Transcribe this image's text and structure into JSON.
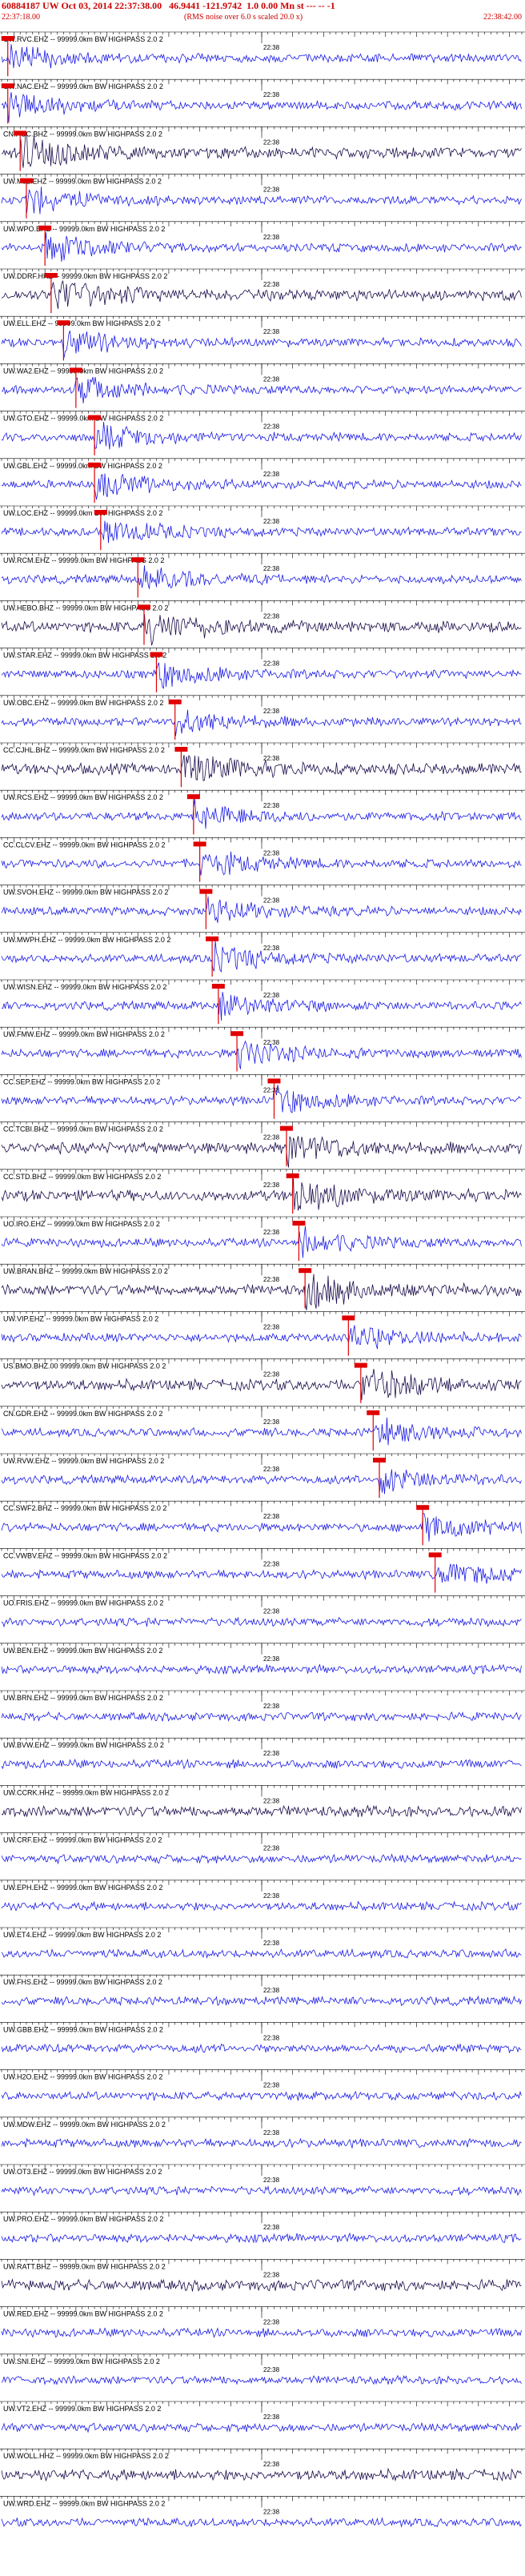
{
  "header": {
    "title": "60884187 UW Oct 03, 2014 22:37:38.00   46.9441 -121.9742  1.0 0.00 Mn st --- -- -1",
    "start_time": "22:37:18.00",
    "end_time": "22:38:42.00",
    "noise_note": "(RMS noise over 6.0 s scaled 20.0 x)"
  },
  "tick_label": "22:38",
  "colors": {
    "trace": "#1a1ae6",
    "dark_trace": "#1a0a4a",
    "pick": "#e00000",
    "text": "#000000"
  },
  "chart_data": {
    "type": "line",
    "title": "60884187 UW Oct 03, 2014 22:37:38.00   46.9441 -121.9742  1.0 0.00 Mn st --- -- -1",
    "x_range": [
      "22:37:18.00",
      "22:38:42.00"
    ],
    "series": [
      {
        "name": "UW.RVC.EHZ -- 99999.0km BW  HIGHPASS  2.0  2",
        "pick": "22:37:19",
        "color": "blue"
      },
      {
        "name": "UW.NAC.EHZ -- 99999.0km BW  HIGHPASS  2.0  2",
        "pick": "22:37:19",
        "color": "blue"
      },
      {
        "name": "CN.PGC.BHZ -- 99999.0km BW  HIGHPASS  2.0  2",
        "pick": "22:37:21",
        "color": "dark"
      },
      {
        "name": "UW.MJ2.EHZ -- 99999.0km BW  HIGHPASS  2.0  2",
        "pick": "22:37:22",
        "color": "blue"
      },
      {
        "name": "UW.WPO.EHZ -- 99999.0km BW  HIGHPASS  2.0  2",
        "pick": "22:37:25",
        "color": "blue"
      },
      {
        "name": "UW.DDRF.HHZ -- 99999.0km BW  HIGHPASS  2.0  2",
        "pick": "22:37:26",
        "color": "dark"
      },
      {
        "name": "UW.ELL.EHZ -- 99999.0km BW  HIGHPASS  2.0  2",
        "pick": "22:37:28",
        "color": "blue"
      },
      {
        "name": "UW.WA2.EHZ -- 99999.0km BW  HIGHPASS  2.0  2",
        "pick": "22:37:30",
        "color": "blue"
      },
      {
        "name": "UW.GTO.EHZ -- 99999.0km BW  HIGHPASS  2.0  2",
        "pick": "22:37:33",
        "color": "blue"
      },
      {
        "name": "UW.GBL.EHZ -- 99999.0km BW  HIGHPASS  2.0  2",
        "pick": "22:37:33",
        "color": "blue"
      },
      {
        "name": "UW.LOC.EHZ -- 99999.0km BW  HIGHPASS  2.0  2",
        "pick": "22:37:34",
        "color": "blue"
      },
      {
        "name": "UW.RCM.EHZ -- 99999.0km BW  HIGHPASS  2.0  2",
        "pick": "22:37:40",
        "color": "blue"
      },
      {
        "name": "UW.HEBO.BHZ -- 99999.0km BW  HIGHPASS  2.0  2",
        "pick": "22:37:41",
        "color": "dark"
      },
      {
        "name": "UW.STAR.EHZ -- 99999.0km BW  HIGHPASS  2.0  2",
        "pick": "22:37:43",
        "color": "blue"
      },
      {
        "name": "UW.OBC.EHZ -- 99999.0km BW  HIGHPASS  2.0  2",
        "pick": "22:37:46",
        "color": "blue"
      },
      {
        "name": "CC.CJHL.BHZ -- 99999.0km BW  HIGHPASS  2.0  2",
        "pick": "22:37:47",
        "color": "dark"
      },
      {
        "name": "UW.RCS.EHZ -- 99999.0km BW  HIGHPASS  2.0  2",
        "pick": "22:37:49",
        "color": "blue"
      },
      {
        "name": "CC.CLCV.EHZ -- 99999.0km BW  HIGHPASS  2.0  2",
        "pick": "22:37:50",
        "color": "blue"
      },
      {
        "name": "UW.SVOH.EHZ -- 99999.0km BW  HIGHPASS  2.0  2",
        "pick": "22:37:51",
        "color": "blue"
      },
      {
        "name": "UW.MWPH.EHZ -- 99999.0km BW  HIGHPASS  2.0  2",
        "pick": "22:37:52",
        "color": "blue"
      },
      {
        "name": "UW.WISN.EHZ -- 99999.0km BW  HIGHPASS  2.0  2",
        "pick": "22:37:53",
        "color": "blue"
      },
      {
        "name": "UW.FMW.EHZ -- 99999.0km BW  HIGHPASS  2.0  2",
        "pick": "22:37:56",
        "color": "blue"
      },
      {
        "name": "CC.SEP.EHZ -- 99999.0km BW  HIGHPASS  2.0  2",
        "pick": "22:38:02",
        "color": "blue"
      },
      {
        "name": "CC.TCBI.BHZ -- 99999.0km BW  HIGHPASS  2.0  2",
        "pick": "22:38:04",
        "color": "dark"
      },
      {
        "name": "CC.STD.BHZ -- 99999.0km BW  HIGHPASS  2.0  2",
        "pick": "22:38:05",
        "color": "dark"
      },
      {
        "name": "UO.IRO.EHZ -- 99999.0km BW  HIGHPASS  2.0  2",
        "pick": "22:38:06",
        "color": "blue"
      },
      {
        "name": "UW.BRAN.BHZ -- 99999.0km BW  HIGHPASS  2.0  2",
        "pick": "22:38:07",
        "color": "dark"
      },
      {
        "name": "UW.VIP.EHZ -- 99999.0km BW  HIGHPASS  2.0  2",
        "pick": "22:38:14",
        "color": "blue"
      },
      {
        "name": "US.BMO.BHZ.00 99999.0km BW  HIGHPASS  2.0  2",
        "pick": "22:38:16",
        "color": "dark"
      },
      {
        "name": "CN.GDR.EHZ -- 99999.0km BW  HIGHPASS  2.0  2",
        "pick": "22:38:18",
        "color": "blue"
      },
      {
        "name": "UW.RVW.EHZ -- 99999.0km BW  HIGHPASS  2.0  2",
        "pick": "22:38:19",
        "color": "blue"
      },
      {
        "name": "CC.SWF2.BHZ -- 99999.0km BW  HIGHPASS  2.0  2",
        "pick": "22:38:26",
        "color": "blue"
      },
      {
        "name": "CC.VWBV.EHZ -- 99999.0km BW  HIGHPASS  2.0  2",
        "pick": "22:38:28",
        "color": "blue"
      },
      {
        "name": "UO.FRIS.EHZ -- 99999.0km BW  HIGHPASS  2.0  2",
        "pick": "",
        "color": "blue"
      },
      {
        "name": "UW.BEN.EHZ -- 99999.0km BW  HIGHPASS  2.0  2",
        "pick": "",
        "color": "blue"
      },
      {
        "name": "UW.BRN.EHZ -- 99999.0km BW  HIGHPASS  2.0  2",
        "pick": "",
        "color": "blue"
      },
      {
        "name": "UW.BVW.EHZ -- 99999.0km BW  HIGHPASS  2.0  2",
        "pick": "",
        "color": "blue"
      },
      {
        "name": "UW.CCRK.HHZ -- 99999.0km BW  HIGHPASS  2.0  2",
        "pick": "",
        "color": "dark"
      },
      {
        "name": "UW.CRF.EHZ -- 99999.0km BW  HIGHPASS  2.0  2",
        "pick": "",
        "color": "blue"
      },
      {
        "name": "UW.EPH.EHZ -- 99999.0km BW  HIGHPASS  2.0  2",
        "pick": "",
        "color": "blue"
      },
      {
        "name": "UW.ET4.EHZ -- 99999.0km BW  HIGHPASS  2.0  2",
        "pick": "",
        "color": "blue"
      },
      {
        "name": "UW.FHS.EHZ -- 99999.0km BW  HIGHPASS  2.0  2",
        "pick": "",
        "color": "blue"
      },
      {
        "name": "UW.GBB.EHZ -- 99999.0km BW  HIGHPASS  2.0  2",
        "pick": "",
        "color": "blue"
      },
      {
        "name": "UW.H2O.EHZ -- 99999.0km BW  HIGHPASS  2.0  2",
        "pick": "",
        "color": "blue"
      },
      {
        "name": "UW.MDW.EHZ -- 99999.0km BW  HIGHPASS  2.0  2",
        "pick": "",
        "color": "blue"
      },
      {
        "name": "UW.OT3.EHZ -- 99999.0km BW  HIGHPASS  2.0  2",
        "pick": "",
        "color": "blue"
      },
      {
        "name": "UW.PRO.EHZ -- 99999.0km BW  HIGHPASS  2.0  2",
        "pick": "",
        "color": "blue"
      },
      {
        "name": "UW.RATT.BHZ -- 99999.0km BW  HIGHPASS  2.0  2",
        "pick": "",
        "color": "dark"
      },
      {
        "name": "UW.RED.EHZ -- 99999.0km BW  HIGHPASS  2.0  2",
        "pick": "",
        "color": "blue"
      },
      {
        "name": "UW.SNI.EHZ -- 99999.0km BW  HIGHPASS  2.0  2",
        "pick": "",
        "color": "blue"
      },
      {
        "name": "UW.VT2.EHZ -- 99999.0km BW  HIGHPASS  2.0  2",
        "pick": "",
        "color": "blue"
      },
      {
        "name": "UW.WOLL.HHZ -- 99999.0km BW  HIGHPASS  2.0  2",
        "pick": "",
        "color": "dark"
      },
      {
        "name": "UW.WRD.EHZ -- 99999.0km BW  HIGHPASS  2.0  2",
        "pick": "",
        "color": "blue"
      }
    ]
  }
}
